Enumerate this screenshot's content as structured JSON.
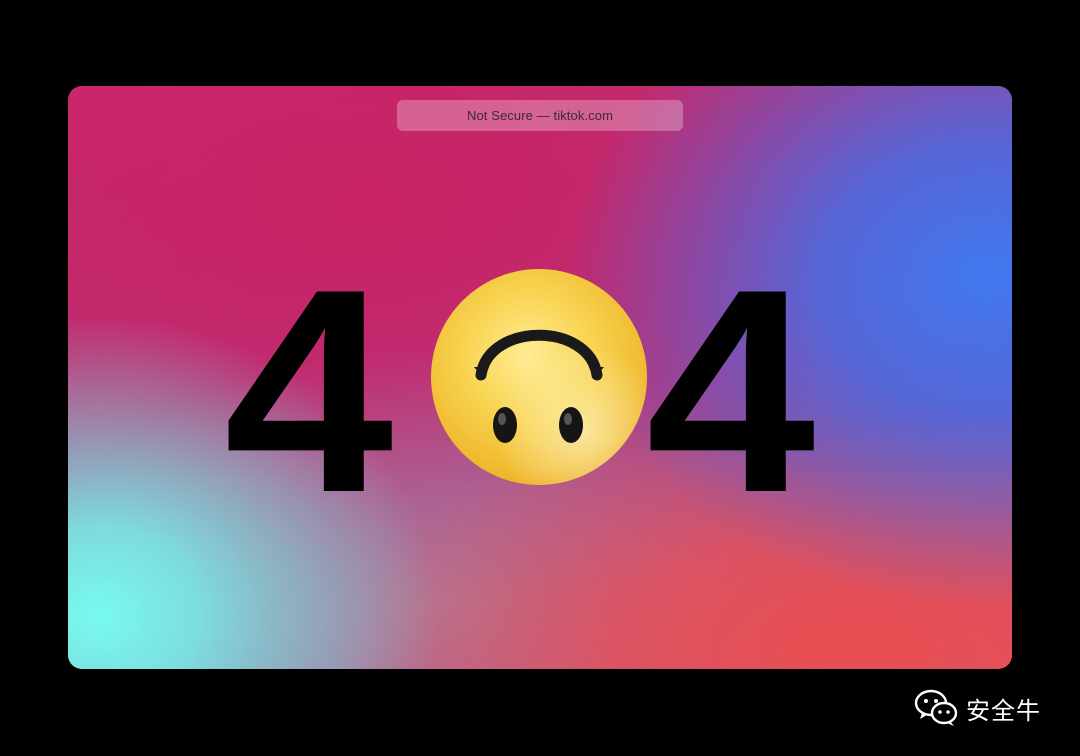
{
  "browser": {
    "address_text": "Not Secure — tiktok.com"
  },
  "error_page": {
    "digit_left": "4",
    "digit_right": "4",
    "center_icon": "upside-down-face-emoji-icon"
  },
  "watermark": {
    "icon": "wechat-icon",
    "text": "安全牛"
  },
  "colors": {
    "background": "#000000",
    "gradient_pink": "#c9286d",
    "gradient_blue": "#4078ee",
    "gradient_cyan": "#78faf0",
    "gradient_red": "#e84e50",
    "digit": "#000000",
    "emoji_face": "#f6cf45"
  }
}
